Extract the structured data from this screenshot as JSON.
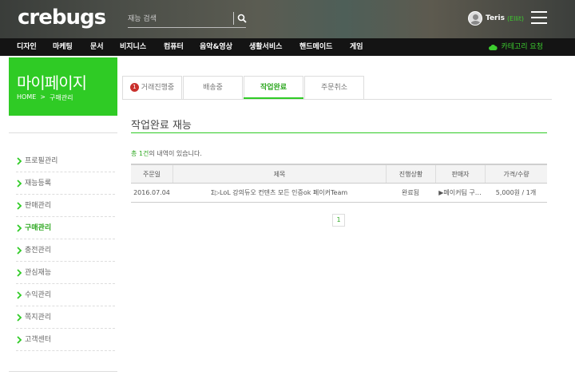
{
  "header": {
    "logo": "crebugs",
    "search": {
      "placeholder": "재능 검색",
      "icon": "search-icon"
    },
    "user": {
      "name": "Teris",
      "level": "(Ellit)"
    },
    "menu_icon": "hamburger-icon"
  },
  "nav": {
    "items": [
      "디자인",
      "마케팅",
      "문서",
      "비지니스",
      "컴퓨터",
      "음악&영상",
      "생활서비스",
      "핸드메이드",
      "게임"
    ],
    "category_request": "카테고리 요청"
  },
  "sidebar": {
    "title": "마이페이지",
    "breadcrumb": [
      "HOME",
      "구매관리"
    ],
    "menu": [
      {
        "label": "프로필관리",
        "active": false
      },
      {
        "label": "재능등록",
        "active": false
      },
      {
        "label": "판매관리",
        "active": false
      },
      {
        "label": "구매관리",
        "active": true
      },
      {
        "label": "충전관리",
        "active": false
      },
      {
        "label": "관심재능",
        "active": false
      },
      {
        "label": "수익관리",
        "active": false
      },
      {
        "label": "쪽지관리",
        "active": false
      },
      {
        "label": "고객센터",
        "active": false
      }
    ]
  },
  "tabs": [
    {
      "label": "거래진행중",
      "badge": "1",
      "active": false
    },
    {
      "label": "배송중",
      "active": false
    },
    {
      "label": "작업완료",
      "active": true
    },
    {
      "label": "주문취소",
      "active": false
    }
  ],
  "section": {
    "title": "작업완료 재능",
    "count_prefix": "총",
    "count_value": "1건",
    "count_suffix": "의 내역이 있습니다."
  },
  "table": {
    "headers": [
      "주문일",
      "제목",
      "진행상황",
      "판매자",
      "가격/수량"
    ],
    "rows": [
      [
        "2016.07.04",
        "Σ▷LoL 강의듀오 컨텐츠 모든 인증ok 페이커Team",
        "완료됨",
        "▶페이커팀 구…",
        "5,000원 / 1개"
      ]
    ]
  },
  "pagination": {
    "current": "1"
  },
  "colors": {
    "brand_green": "#2fcb25",
    "nav_bg": "#141414",
    "badge_red": "#c9302c"
  }
}
